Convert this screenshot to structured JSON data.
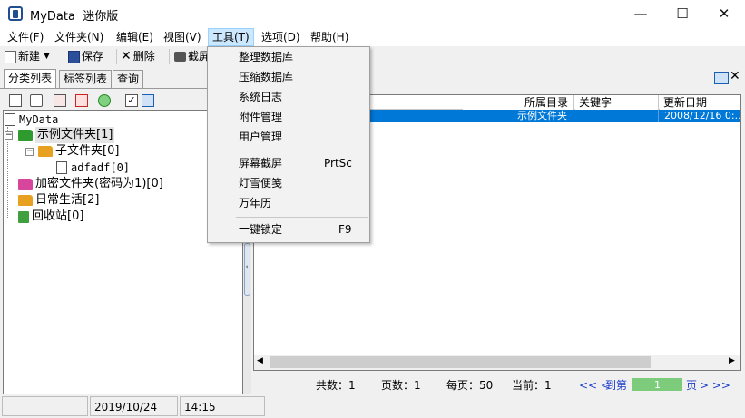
{
  "window": {
    "title": "MyData  迷你版",
    "minimize_glyph": "—",
    "maximize_glyph": "☐",
    "close_glyph": "✕"
  },
  "menubar": {
    "items": [
      "文件(F)",
      "文件夹(N)",
      "编辑(E)",
      "视图(V)",
      "工具(T)",
      "选项(D)",
      "帮助(H)"
    ]
  },
  "toolbar": {
    "new_label": "新建",
    "save_label": "保存",
    "delete_label": "删除",
    "screenshot_label": "截屏"
  },
  "tabs": [
    "分类列表",
    "标签列表",
    "查询"
  ],
  "tree": {
    "root": "MyData",
    "items": [
      {
        "label": "示例文件夹[1]",
        "color": "#2f9b2f"
      },
      {
        "label": "子文件夹[0]",
        "color": "#e8a020"
      },
      {
        "label": "adfadf[0]",
        "color": "#ffffff"
      },
      {
        "label": "加密文件夹(密码为1)[0]",
        "color": "#d7469c"
      },
      {
        "label": "日常生活[2]",
        "color": "#e8a020"
      },
      {
        "label": "回收站[0]",
        "color": "#40a040"
      }
    ]
  },
  "grid": {
    "columns": [
      "所属目录",
      "关键字",
      "更新日期"
    ],
    "row": {
      "folder": "示例文件夹",
      "keyword": "",
      "date": "2008/12/16 0:..."
    }
  },
  "pager": {
    "total_label": "共数：",
    "total": "1",
    "pages_label": "页数：",
    "pages": "1",
    "per_page_label": "每页：",
    "per_page": "50",
    "current_label": "当前：",
    "current": "1",
    "prev": "<<  <",
    "goto_label": "到第",
    "goto_value": "1",
    "page_suffix": "页",
    "next": ">  >>"
  },
  "status": {
    "date": "2019/10/24",
    "time": "14:15"
  },
  "tools_menu": {
    "items": [
      {
        "label": "整理数据库",
        "shortcut": ""
      },
      {
        "label": "压缩数据库",
        "shortcut": ""
      },
      {
        "label": "系统日志",
        "shortcut": ""
      },
      {
        "label": "附件管理",
        "shortcut": ""
      },
      {
        "label": "用户管理",
        "shortcut": ""
      },
      {
        "label": "屏幕截屏",
        "shortcut": "PrtSc"
      },
      {
        "label": "灯雪便笺",
        "shortcut": ""
      },
      {
        "label": "万年历",
        "shortcut": ""
      },
      {
        "label": "一键锁定",
        "shortcut": "F9"
      }
    ]
  },
  "colors": {
    "selection": "#0078d7",
    "pager_link": "#1a3cc8",
    "page_input": "#7ccc7c"
  }
}
